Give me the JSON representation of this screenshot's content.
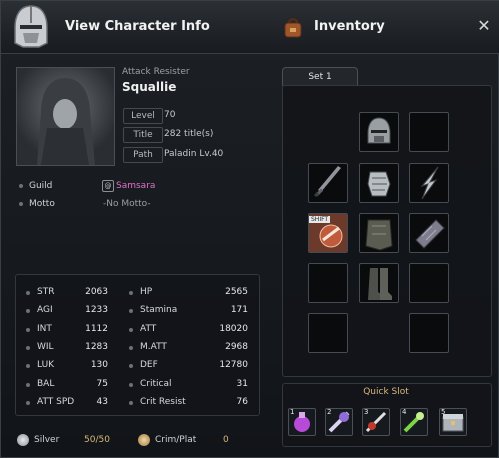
{
  "window": {
    "character_title": "View Character Info",
    "inventory_title": "Inventory",
    "close_label": "✕"
  },
  "character": {
    "class_label": "Attack Resister",
    "name": "Squallie",
    "fields": [
      {
        "label": "Level",
        "value": "70"
      },
      {
        "label": "Title",
        "value": "282 title(s)"
      },
      {
        "label": "Path",
        "value": "Paladin Lv.40"
      }
    ],
    "guild_label": "Guild",
    "guild_value": "Samsara",
    "motto_label": "Motto",
    "motto_value": "-No Motto-"
  },
  "stats": {
    "left": [
      {
        "label": "STR",
        "value": "2063"
      },
      {
        "label": "AGI",
        "value": "1233"
      },
      {
        "label": "INT",
        "value": "1112"
      },
      {
        "label": "WIL",
        "value": "1283"
      },
      {
        "label": "LUK",
        "value": "130"
      },
      {
        "label": "BAL",
        "value": "75"
      },
      {
        "label": "ATT SPD",
        "value": "43"
      }
    ],
    "right": [
      {
        "label": "HP",
        "value": "2565"
      },
      {
        "label": "Stamina",
        "value": "171"
      },
      {
        "label": "ATT",
        "value": "18020"
      },
      {
        "label": "M.ATT",
        "value": "2968"
      },
      {
        "label": "DEF",
        "value": "12780"
      },
      {
        "label": "Critical",
        "value": "31"
      },
      {
        "label": "Crit Resist",
        "value": "76"
      }
    ]
  },
  "currency": {
    "silver_label": "Silver",
    "silver_value": "50/50",
    "crim_label": "Crim/Plat",
    "crim_value": "0"
  },
  "inventory": {
    "tab_label": "Set 1",
    "shift_badge": "SHIFT",
    "quick_slot_label": "Quick Slot",
    "quick_slot_numbers": [
      "1",
      "2",
      "3",
      "4",
      "5"
    ]
  },
  "colors": {
    "guild": "#e070c8",
    "accent_gold": "#d6b77a"
  }
}
